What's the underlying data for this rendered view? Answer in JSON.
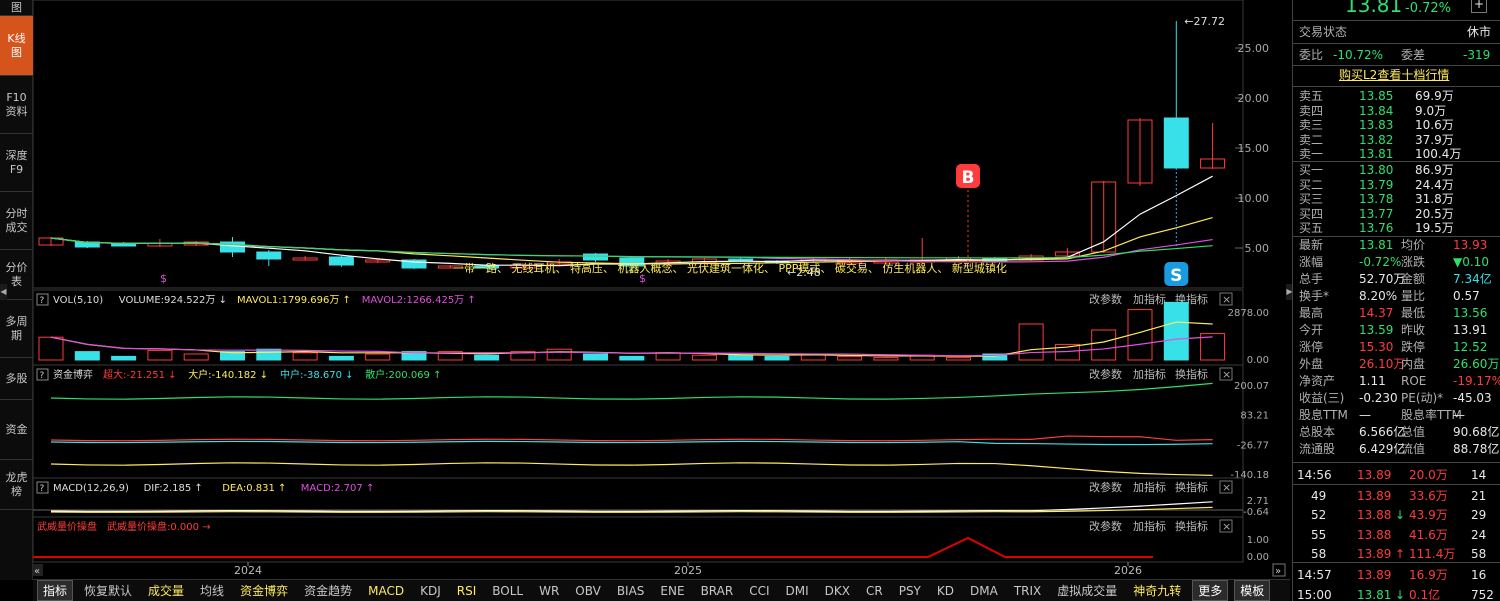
{
  "left_tabs": [
    {
      "label": "图",
      "height": 16
    },
    {
      "label": "K线图",
      "height": 60,
      "active": true
    },
    {
      "label": "F10资料",
      "height": 58
    },
    {
      "label": "深度F9",
      "height": 58
    },
    {
      "label": "分时成交",
      "height": 58
    },
    {
      "label": "分价表",
      "height": 50
    },
    {
      "label": "多周期",
      "height": 58
    },
    {
      "label": "多股",
      "height": 42
    },
    {
      "label": "资金",
      "height": 60
    },
    {
      "label": "龙虎榜",
      "height": 50
    }
  ],
  "price_axis": [
    "25.00",
    "20.00",
    "15.00",
    "10.00",
    "5.00"
  ],
  "high_label": "27.72",
  "low_label": "2.48",
  "concept_text": "一带一路、 无线耳机、 特高压、 机器人概念、 光伏建筑一体化、 PPP模式、 碳交易、 仿生机器人、 新型城镇化",
  "signals": {
    "buy": "B",
    "sell": "S",
    "mark": "$"
  },
  "x_axis": [
    "2024",
    "2025",
    "2026"
  ],
  "panels": {
    "vol": {
      "title": "VOL(5,10)",
      "v1": "VOLUME:924.522万",
      "v1_arrow": "↓",
      "v2": "MAVOL1:1799.696万",
      "v2_arrow": "↑",
      "v3": "MAVOL2:1266.425万",
      "v3_arrow": "↑",
      "axis": [
        "2878.00",
        "0.00"
      ]
    },
    "fund": {
      "title": "资金博弈",
      "v1": "超大:-21.251",
      "v1_arrow": "↓",
      "v2": "大户:-140.182",
      "v2_arrow": "↓",
      "v3": "中户:-38.670",
      "v3_arrow": "↓",
      "v4": "散户:200.069",
      "v4_arrow": "↑",
      "axis": [
        "200.07",
        "83.21",
        "-26.77",
        "-140.18"
      ]
    },
    "macd": {
      "title": "MACD(12,26,9)",
      "v1": "DIF:2.185",
      "v1_arrow": "↑",
      "v2": "DEA:0.831",
      "v2_arrow": "↑",
      "v3": "MACD:2.707",
      "v3_arrow": "↑",
      "axis": [
        "2.71",
        "-0.64"
      ]
    },
    "wxl": {
      "title": "武威量价操盘",
      "v1": "武威量价操盘:0.000",
      "v1_arrow": "→",
      "axis": [
        "1.00",
        "0.00"
      ]
    }
  },
  "panel_buttons": {
    "params": "改参数",
    "add": "加指标",
    "swap": "换指标",
    "close": "×",
    "collapse": "?"
  },
  "bottom_tabs": [
    "指标",
    "恢复默认",
    "成交量",
    "均线",
    "资金博弈",
    "资金趋势",
    "MACD",
    "KDJ",
    "RSI",
    "BOLL",
    "WR",
    "OBV",
    "BIAS",
    "ENE",
    "BRAR",
    "CCI",
    "DMI",
    "DKX",
    "CR",
    "PSY",
    "KD",
    "DMA",
    "TRIX",
    "虚拟成交量",
    "神奇九转",
    "更多",
    "模板"
  ],
  "quote": {
    "price": "13.81",
    "change_pct": "-0.72%",
    "plus": "+",
    "status_label": "交易状态",
    "status": "休市",
    "weibi_label": "委比",
    "weibi": "-10.72%",
    "weicha_label": "委差",
    "weicha": "-319",
    "l2_link": "购买L2查看十档行情",
    "asks": [
      [
        "卖五",
        "13.85",
        "69.9万"
      ],
      [
        "卖四",
        "13.84",
        "9.0万"
      ],
      [
        "卖三",
        "13.83",
        "10.6万"
      ],
      [
        "卖二",
        "13.82",
        "37.9万"
      ],
      [
        "卖一",
        "13.81",
        "100.4万"
      ]
    ],
    "bids": [
      [
        "买一",
        "13.80",
        "86.9万"
      ],
      [
        "买二",
        "13.79",
        "24.4万"
      ],
      [
        "买三",
        "13.78",
        "31.8万"
      ],
      [
        "买四",
        "13.77",
        "20.5万"
      ],
      [
        "买五",
        "13.76",
        "19.5万"
      ]
    ],
    "stats": [
      [
        "最新",
        "13.81",
        "均价",
        "13.93"
      ],
      [
        "涨幅",
        "-0.72%",
        "涨跌",
        "▼0.10"
      ],
      [
        "总手",
        "52.70万",
        "金额",
        "7.34亿"
      ],
      [
        "换手*",
        "8.20%",
        "量比",
        "0.57"
      ],
      [
        "最高",
        "14.37",
        "最低",
        "13.56"
      ],
      [
        "今开",
        "13.59",
        "昨收",
        "13.91"
      ],
      [
        "涨停",
        "15.30",
        "跌停",
        "12.52"
      ],
      [
        "外盘",
        "26.10万",
        "内盘",
        "26.60万"
      ],
      [
        "净资产",
        "1.11",
        "ROE",
        "-19.17%"
      ],
      [
        "收益(三)",
        "-0.230",
        "PE(动)*",
        "-45.03"
      ],
      [
        "股息TTM",
        "—",
        "股息率TTM",
        "—"
      ],
      [
        "总股本",
        "6.566亿",
        "总值",
        "90.68亿"
      ],
      [
        "流通股",
        "6.429亿",
        "流值",
        "88.78亿"
      ]
    ],
    "ticks": [
      [
        "14:56",
        "13.89",
        "",
        "20.0万",
        "14"
      ],
      [
        "49",
        "13.89",
        "",
        "33.6万",
        "21"
      ],
      [
        "52",
        "13.88",
        "↓",
        "43.9万",
        "29"
      ],
      [
        "55",
        "13.88",
        "",
        "41.6万",
        "24"
      ],
      [
        "58",
        "13.89",
        "↑",
        "111.4万",
        "58"
      ],
      [
        "14:57",
        "13.89",
        "",
        "16.9万",
        "16"
      ],
      [
        "15:00",
        "13.81",
        "↓",
        "0.1亿",
        "752"
      ]
    ]
  },
  "colors": {
    "up": "#ff3c3c",
    "down": "#2ee06b",
    "cyan": "#38e0e8",
    "yellow": "#ffea5e",
    "magenta": "#e050e0",
    "orange": "#d4541c"
  },
  "chart_data": {
    "type": "candlestick",
    "candles": [
      {
        "o": 5.3,
        "c": 6.0,
        "h": 6.1,
        "l": 5.2
      },
      {
        "o": 5.6,
        "c": 5.1,
        "h": 5.7,
        "l": 5.0
      },
      {
        "o": 5.4,
        "c": 5.3,
        "h": 5.6,
        "l": 5.2
      },
      {
        "o": 5.2,
        "c": 5.5,
        "h": 5.9,
        "l": 5.1
      },
      {
        "o": 5.3,
        "c": 5.6,
        "h": 5.7,
        "l": 5.2
      },
      {
        "o": 5.6,
        "c": 4.6,
        "h": 6.1,
        "l": 4.1
      },
      {
        "o": 4.6,
        "c": 3.9,
        "h": 4.8,
        "l": 3.2
      },
      {
        "o": 3.9,
        "c": 4.0,
        "h": 4.2,
        "l": 3.8
      },
      {
        "o": 4.1,
        "c": 3.3,
        "h": 4.2,
        "l": 3.1
      },
      {
        "o": 3.6,
        "c": 3.8,
        "h": 3.9,
        "l": 3.5
      },
      {
        "o": 3.8,
        "c": 3.0,
        "h": 3.9,
        "l": 2.9
      },
      {
        "o": 3.1,
        "c": 3.2,
        "h": 3.3,
        "l": 3.0
      },
      {
        "o": 3.2,
        "c": 3.1,
        "h": 3.4,
        "l": 2.9
      },
      {
        "o": 3.0,
        "c": 3.3,
        "h": 3.5,
        "l": 2.9
      },
      {
        "o": 3.4,
        "c": 3.6,
        "h": 3.9,
        "l": 3.2
      },
      {
        "o": 4.4,
        "c": 3.8,
        "h": 4.5,
        "l": 3.6
      },
      {
        "o": 4.0,
        "c": 3.2,
        "h": 4.2,
        "l": 2.6
      },
      {
        "o": 3.4,
        "c": 3.7,
        "h": 3.9,
        "l": 3.2
      },
      {
        "o": 3.6,
        "c": 3.9,
        "h": 4.0,
        "l": 3.4
      },
      {
        "o": 3.9,
        "c": 3.8,
        "h": 4.1,
        "l": 3.6
      },
      {
        "o": 3.7,
        "c": 3.6,
        "h": 3.8,
        "l": 3.4
      },
      {
        "o": 3.6,
        "c": 3.9,
        "h": 4.0,
        "l": 3.5
      },
      {
        "o": 3.6,
        "c": 3.7,
        "h": 4.0,
        "l": 3.5
      },
      {
        "o": 3.5,
        "c": 3.8,
        "h": 4.0,
        "l": 3.4
      },
      {
        "o": 3.7,
        "c": 3.8,
        "h": 6.0,
        "l": 3.5
      },
      {
        "o": 3.8,
        "c": 4.0,
        "h": 4.2,
        "l": 3.7
      },
      {
        "o": 4.0,
        "c": 3.7,
        "h": 4.1,
        "l": 3.5
      },
      {
        "o": 3.8,
        "c": 4.2,
        "h": 4.4,
        "l": 3.7
      },
      {
        "o": 4.2,
        "c": 4.6,
        "h": 5.0,
        "l": 4.1
      },
      {
        "o": 4.6,
        "c": 11.6,
        "h": 11.7,
        "l": 4.5
      },
      {
        "o": 11.5,
        "c": 17.8,
        "h": 18.0,
        "l": 11.2
      },
      {
        "o": 18.0,
        "c": 13.0,
        "h": 27.7,
        "l": 12.9
      },
      {
        "o": 13.0,
        "c": 13.9,
        "h": 17.5,
        "l": 12.9
      }
    ]
  }
}
